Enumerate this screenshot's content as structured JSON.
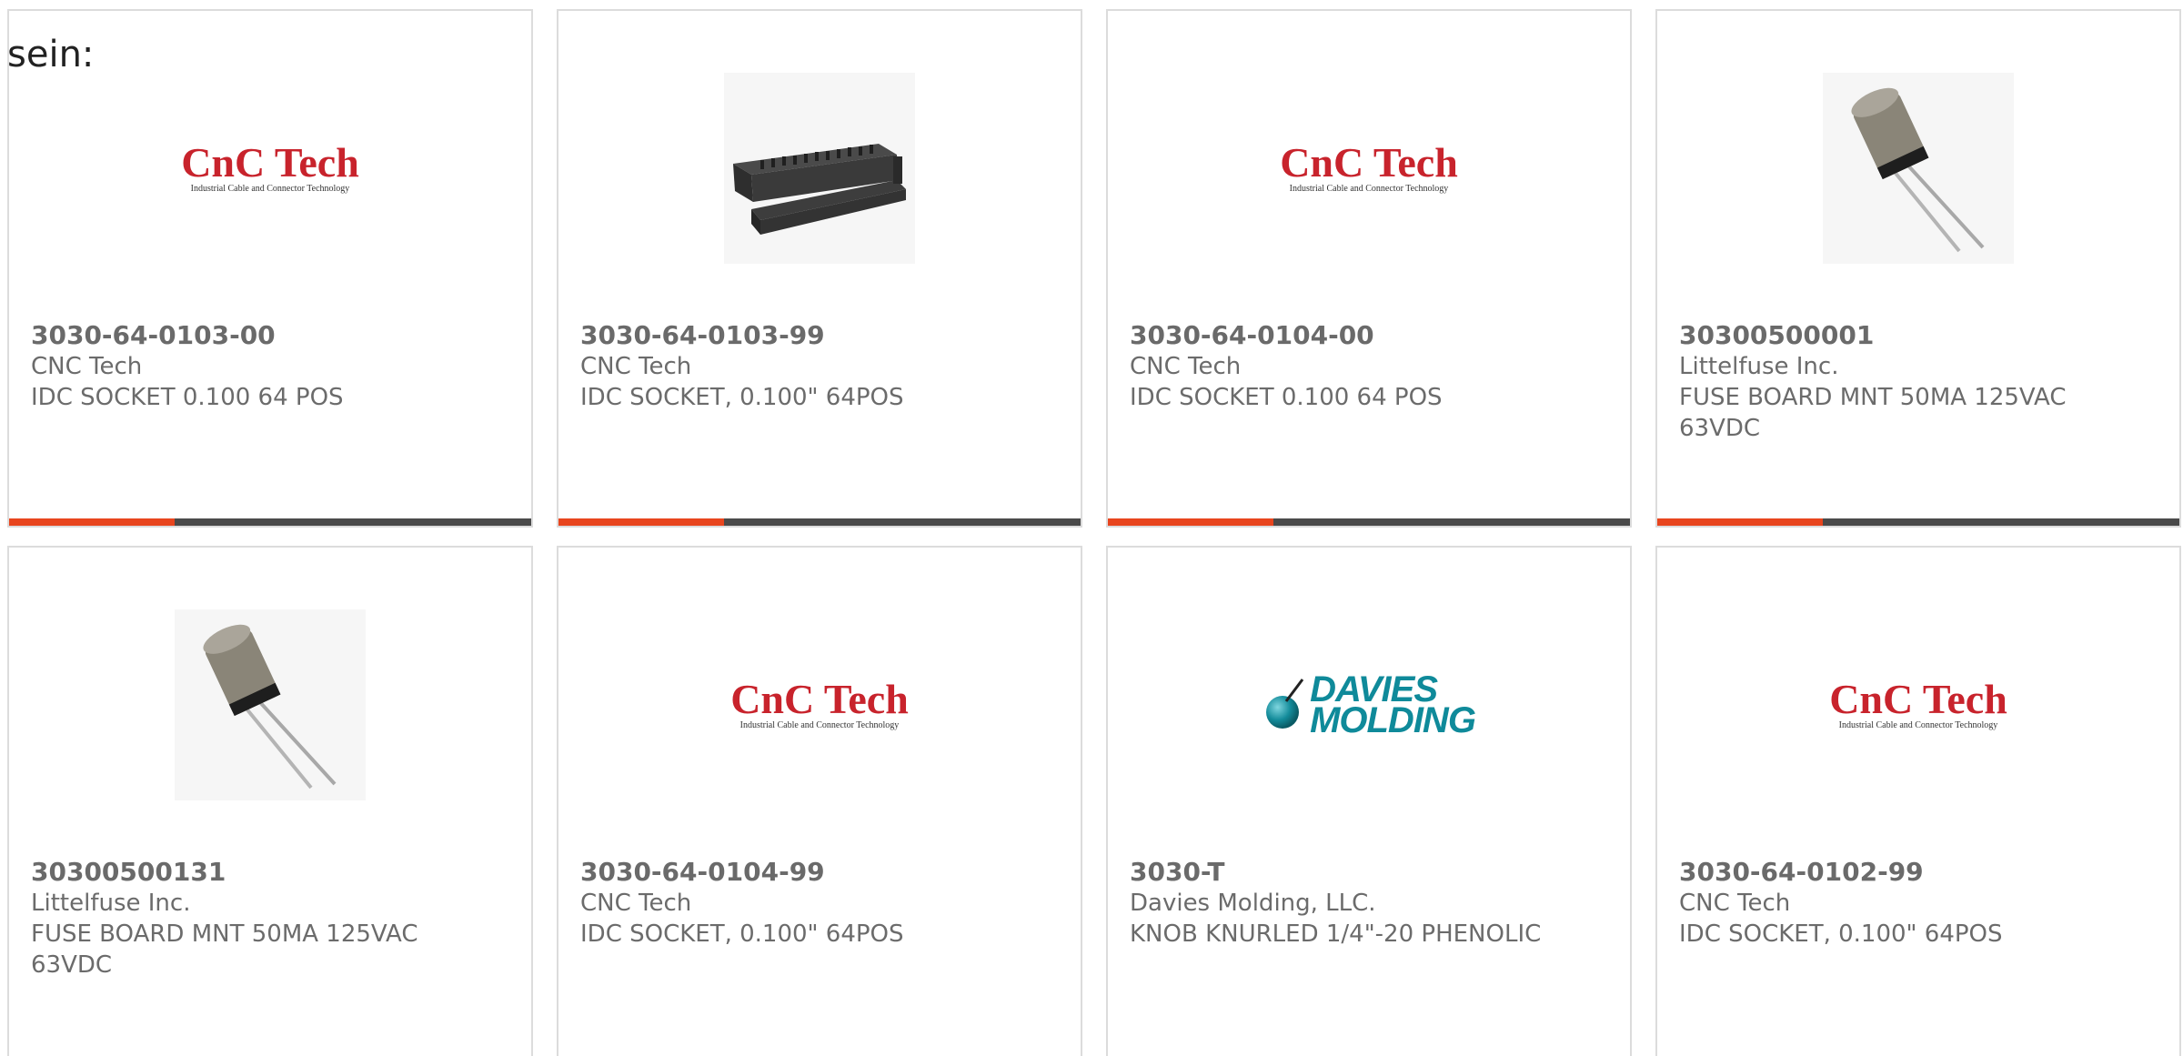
{
  "intro_text": "sein:",
  "colors": {
    "accent": "#e8451e",
    "bar": "#4a4a4a",
    "cnc_red": "#c8232c",
    "davies_teal": "#0f8a9a"
  },
  "products": [
    {
      "part_number": "3030-64-0103-00",
      "manufacturer": "CNC Tech",
      "description": "IDC SOCKET 0.100 64 POS",
      "image": "cnc-tech-logo",
      "logo_main": "CnC Tech",
      "logo_sub": "Industrial Cable and Connector Technology"
    },
    {
      "part_number": "3030-64-0103-99",
      "manufacturer": "CNC Tech",
      "description": "IDC SOCKET, 0.100\" 64POS",
      "image": "idc-socket-photo"
    },
    {
      "part_number": "3030-64-0104-00",
      "manufacturer": "CNC Tech",
      "description": "IDC SOCKET 0.100 64 POS",
      "image": "cnc-tech-logo",
      "logo_main": "CnC Tech",
      "logo_sub": "Industrial Cable and Connector Technology"
    },
    {
      "part_number": "30300500001",
      "manufacturer": "Littelfuse Inc.",
      "description": "FUSE BOARD MNT 50MA 125VAC 63VDC",
      "image": "fuse-photo"
    },
    {
      "part_number": "30300500131",
      "manufacturer": "Littelfuse Inc.",
      "description": "FUSE BOARD MNT 50MA 125VAC 63VDC",
      "image": "fuse-photo"
    },
    {
      "part_number": "3030-64-0104-99",
      "manufacturer": "CNC Tech",
      "description": "IDC SOCKET, 0.100\" 64POS",
      "image": "cnc-tech-logo",
      "logo_main": "CnC Tech",
      "logo_sub": "Industrial Cable and Connector Technology"
    },
    {
      "part_number": "3030-T",
      "manufacturer": "Davies Molding, LLC.",
      "description": "KNOB KNURLED 1/4\"-20 PHENOLIC",
      "image": "davies-molding-logo",
      "logo_main": "DAVIES",
      "logo_sub": "MOLDING"
    },
    {
      "part_number": "3030-64-0102-99",
      "manufacturer": "CNC Tech",
      "description": "IDC SOCKET, 0.100\" 64POS",
      "image": "cnc-tech-logo",
      "logo_main": "CnC Tech",
      "logo_sub": "Industrial Cable and Connector Technology"
    }
  ]
}
